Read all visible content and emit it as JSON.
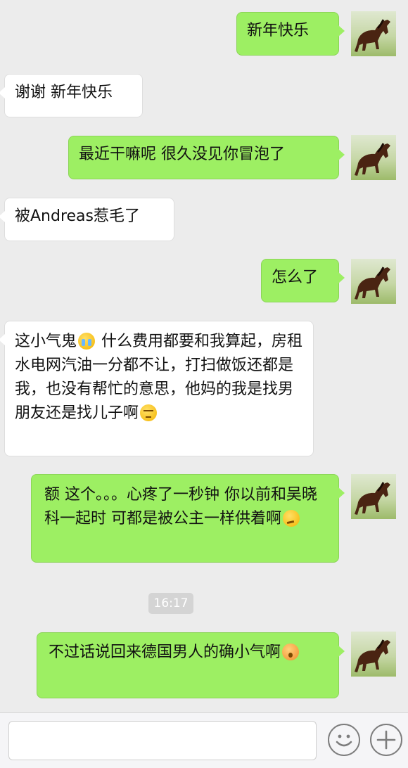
{
  "messages": [
    {
      "id": "m1",
      "side": "sent",
      "text": "新年快乐"
    },
    {
      "id": "m2",
      "side": "recv",
      "text": "谢谢 新年快乐"
    },
    {
      "id": "m3",
      "side": "sent",
      "text": "最近干嘛呢 很久没见你冒泡了"
    },
    {
      "id": "m4",
      "side": "recv",
      "text": "被Andreas惹毛了"
    },
    {
      "id": "m5",
      "side": "sent",
      "text": "怎么了"
    },
    {
      "id": "m6",
      "side": "recv",
      "text_a": "这小气鬼",
      "emoji_a": "crying-face-emoji",
      "text_b": " 什么费用都要和我算起，房租水电网汽油一分都不让，打扫做饭还都是我，也没有帮忙的意思，他妈的我是找男朋友还是找儿子啊",
      "emoji_b": "unamused-face-emoji"
    },
    {
      "id": "m7",
      "side": "sent",
      "text": "额 这个。。。心疼了一秒钟 你以前和吴晓科一起时 可都是被公主一样供着啊",
      "emoji": "thinking-face-emoji"
    },
    {
      "id": "m8",
      "side": "sent",
      "text": "不过话说回来德国男人的确小气啊",
      "emoji": "astonished-face-emoji"
    }
  ],
  "timestamp": "16:17",
  "input": {
    "placeholder": ""
  },
  "icons": {
    "emoji_button": "smiley-icon",
    "plus_button": "plus-icon",
    "avatar": "horse-avatar"
  },
  "colors": {
    "sent_bubble": "#9def63",
    "recv_bubble": "#ffffff",
    "background": "#ececec"
  }
}
